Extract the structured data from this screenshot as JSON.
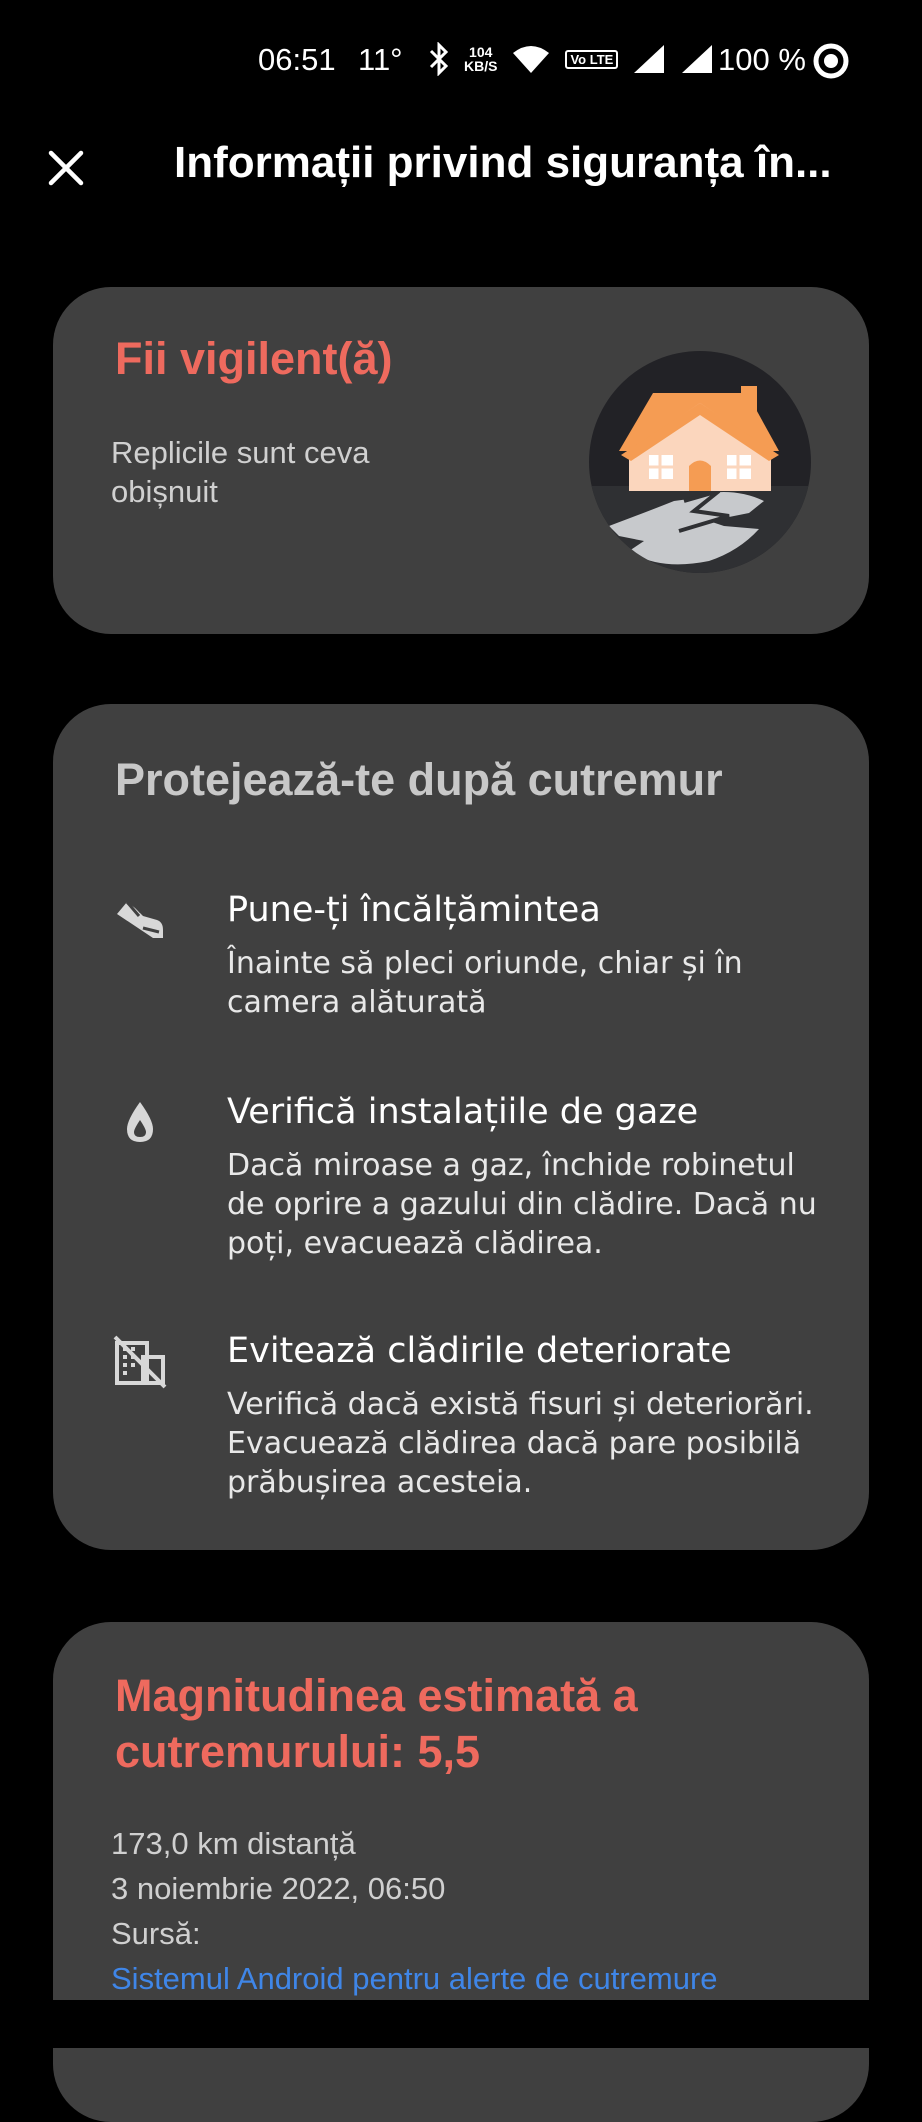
{
  "status_bar": {
    "time": "06:51",
    "temperature": "11°",
    "net_speed_value": "104",
    "net_speed_unit": "KB/S",
    "volte_label": "Vo LTE",
    "battery": "100 %",
    "icons": [
      "bluetooth-icon",
      "wifi-icon",
      "volte-icon",
      "signal-icon",
      "signal-icon",
      "battery-ring-icon"
    ]
  },
  "app_bar": {
    "close_icon": "close-icon",
    "title": "Informații privind siguranța în..."
  },
  "alert_card": {
    "title": "Fii vigilent(ă)",
    "subtitle": "Replicile sunt ceva obișnuit",
    "illustration": "house-cracked-ground-icon"
  },
  "protect_card": {
    "title": "Protejează-te după cutremur",
    "tips": [
      {
        "icon": "shoe-icon",
        "title": "Pune-ți încălțămintea",
        "body": "Înainte să pleci oriunde, chiar și în camera alăturată"
      },
      {
        "icon": "gas-drop-icon",
        "title": "Verifică instalațiile de gaze",
        "body": "Dacă miroase a gaz, închide robinetul de oprire a gazului din clădire. Dacă nu poți, evacuează clădirea."
      },
      {
        "icon": "damaged-building-icon",
        "title": "Evitează clădirile deteriorate",
        "body": "Verifică dacă există fisuri și deteriorări. Evacuează clădirea dacă pare posibilă prăbușirea acesteia."
      }
    ]
  },
  "magnitude_card": {
    "title": "Magnitudinea estimată a cutremurului: 5,5",
    "distance": "173,0 km distanță",
    "datetime": "3 noiembrie 2022, 06:50",
    "source_label": "Sursă:",
    "source_link": "Sistemul Android pentru alerte de cutremure"
  },
  "colors": {
    "background": "#000000",
    "card": "#404040",
    "accent_red": "#ee6a5e",
    "link_blue": "#3f86e8"
  }
}
